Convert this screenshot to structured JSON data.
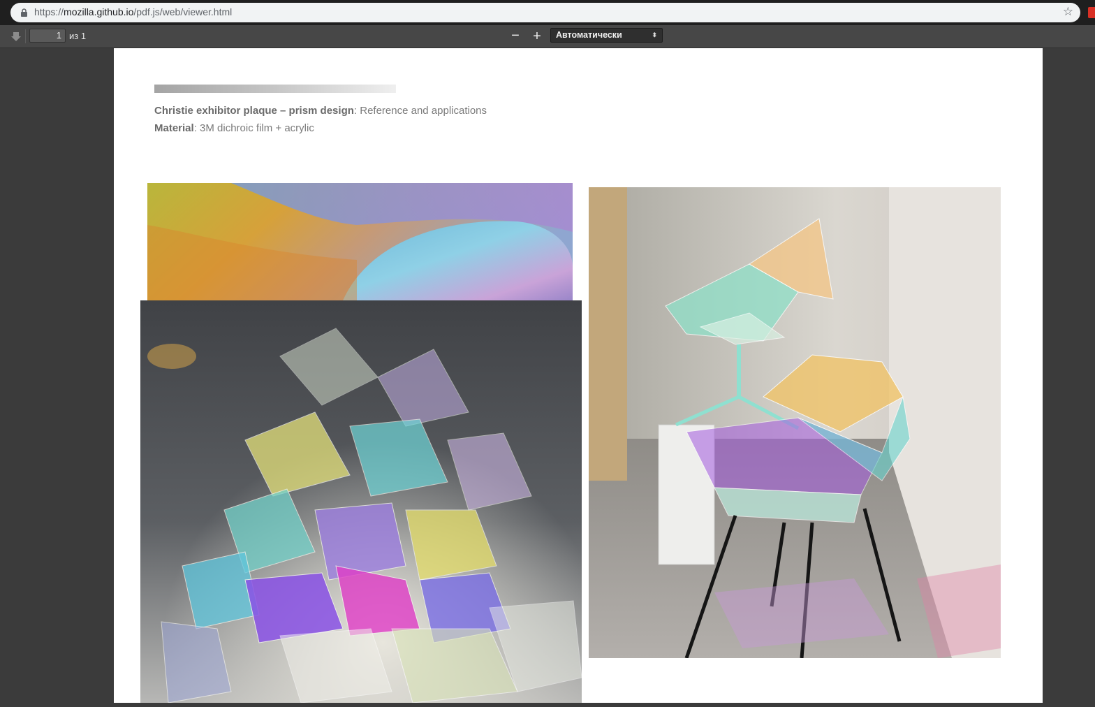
{
  "browser": {
    "url_scheme": "https://",
    "url_host": "mozilla.github.io",
    "url_path": "/pdf.js/web/viewer.html"
  },
  "toolbar": {
    "page_number": "1",
    "page_count": "из 1",
    "zoom_out_label": "−",
    "zoom_in_label": "+",
    "zoom_value": "Автоматически"
  },
  "document": {
    "caption1_bold": "Christie exhibitor plaque – prism design",
    "caption1_rest": ": Reference and applications",
    "caption2_bold": "Material",
    "caption2_rest": ": 3M dichroic film + acrylic"
  },
  "icons": {
    "lock": "lock-icon",
    "star": "star-icon",
    "sidebar": "sidebar-toggle-icon"
  }
}
